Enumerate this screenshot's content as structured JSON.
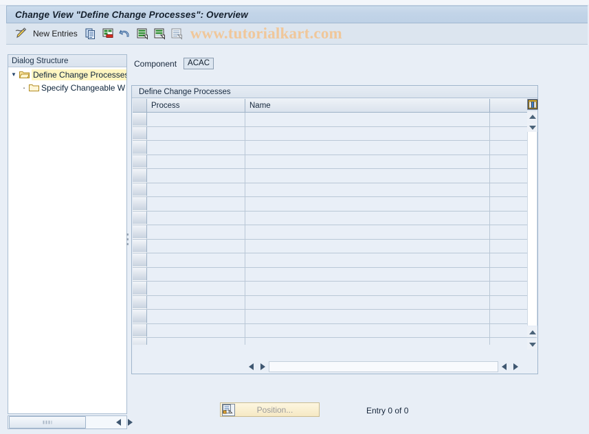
{
  "window": {
    "title": "Change View \"Define Change Processes\": Overview"
  },
  "toolbar": {
    "new_entries_label": "New Entries",
    "watermark": "www.tutorialkart.com",
    "icons": [
      {
        "name": "pencil-display-change-icon"
      },
      {
        "name": "copy-as-icon"
      },
      {
        "name": "delete-icon"
      },
      {
        "name": "undo-icon"
      },
      {
        "name": "select-all-icon"
      },
      {
        "name": "deselect-all-icon"
      },
      {
        "name": "select-block-icon"
      }
    ]
  },
  "sidebar": {
    "header": "Dialog Structure",
    "items": [
      {
        "label": "Define Change Processes",
        "selected": true,
        "level": 0
      },
      {
        "label": "Specify Changeable W",
        "selected": false,
        "level": 1
      }
    ]
  },
  "main": {
    "component": {
      "label": "Component",
      "value": "ACAC"
    },
    "table": {
      "title": "Define Change Processes",
      "columns": [
        "Process",
        "Name"
      ],
      "rows": [],
      "empty_row_count": 18
    },
    "footer": {
      "position_button": "Position...",
      "entry_status": "Entry 0 of 0"
    }
  },
  "colors": {
    "titlebar": "#c2d4e8",
    "toolbar": "#dce5ef",
    "background": "#e8eef6",
    "selection_highlight": "#fff5c0",
    "watermark": "#f0c79a",
    "button_accent": "#f6e9c4"
  }
}
